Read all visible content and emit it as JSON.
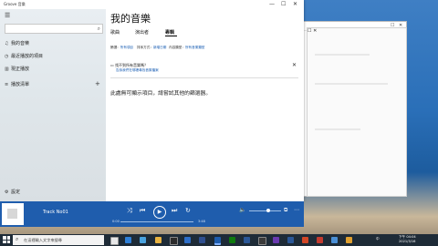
{
  "app": {
    "title": "Groove 音樂",
    "window_controls": {
      "minimize": "—",
      "maximize": "☐",
      "close": "✕"
    }
  },
  "sidebar": {
    "menu_glyph": "☰",
    "search_placeholder": "",
    "items": [
      {
        "label": "我的音樂",
        "icon": "music-note-icon",
        "glyph": "♫"
      },
      {
        "label": "最近播放的項目",
        "icon": "clock-icon",
        "glyph": "◷"
      },
      {
        "label": "現正播放",
        "icon": "now-playing-icon",
        "glyph": "▥"
      },
      {
        "label": "播放清單",
        "icon": "playlist-icon",
        "glyph": "≡"
      }
    ],
    "add_glyph": "+",
    "settings_label": "設定",
    "settings_glyph": "⚙"
  },
  "main": {
    "title": "我的音樂",
    "tabs": [
      {
        "label": "歌曲",
        "active": false
      },
      {
        "label": "演出者",
        "active": false
      },
      {
        "label": "專輯",
        "active": true
      }
    ],
    "filters": [
      {
        "label": "篩選：",
        "value": "所有項目"
      },
      {
        "label": "排序方式：",
        "value": "新增日期"
      },
      {
        "label": "內容類型：",
        "value": "所有音樂類型"
      }
    ],
    "notice": {
      "title": "找不到所有音樂嗎？",
      "link": "告訴我們在哪裡尋找音樂檔案"
    },
    "empty_message": "此處無可顯示項目，請嘗試其他的篩選器。"
  },
  "player": {
    "track_title": "Track No01",
    "time_elapsed": "0:00",
    "time_total": "3:48",
    "progress": 0,
    "volume": 0.6,
    "controls": {
      "shuffle": "⤨",
      "previous": "⏮",
      "play": "▶",
      "next": "⏭",
      "repeat": "↻",
      "volume": "🔈",
      "miniplayer": "⧉",
      "fullscreen": "⤢",
      "more": "⋯"
    }
  },
  "taskbar": {
    "search_placeholder": "在這裡輸入文字來搜尋",
    "tray_lang": "中",
    "clock": "下午 04:04\n2021/3/16"
  },
  "colors": {
    "accent": "#1f5dad",
    "taskbar": "#1e2b37"
  }
}
